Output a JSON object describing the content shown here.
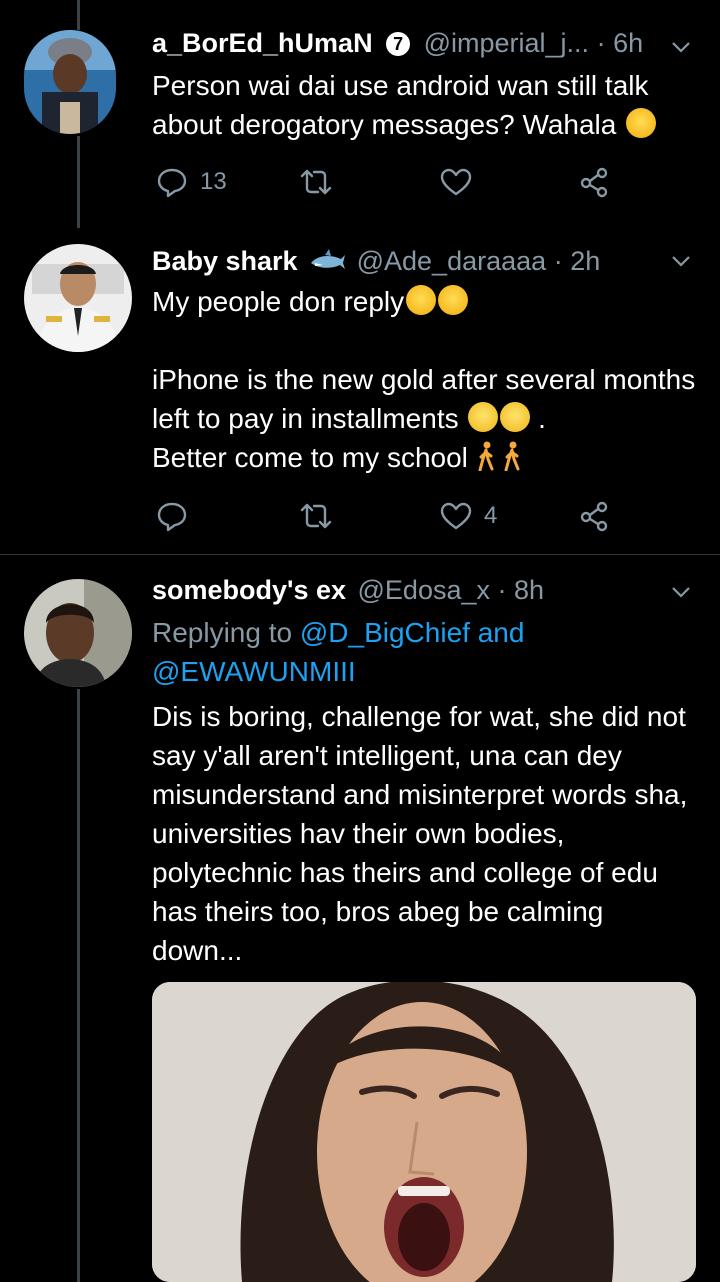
{
  "tweets": [
    {
      "display_name": "a_BorEd_hUmaN",
      "badge": "7",
      "handle": "@imperial_j...",
      "time": "6h",
      "text": "Person wai dai use android wan still talk about derogatory messages? Wahala",
      "replies": "13",
      "retweets": "",
      "likes": ""
    },
    {
      "display_name": "Baby shark",
      "handle": "@Ade_daraaaa",
      "time": "2h",
      "text_line1": "My people don reply",
      "text_para2a": "iPhone is the new gold after several months left to pay in installments",
      "text_para2b": ".",
      "text_para2c": "Better come to my school",
      "replies": "",
      "retweets": "",
      "likes": "4"
    },
    {
      "display_name": "somebody's ex",
      "handle": "@Edosa_x",
      "time": "8h",
      "replying_prefix": "Replying to",
      "replying_user1": "@D_BigChief",
      "replying_and": "and",
      "replying_user2": "@EWAWUNMIII",
      "text": "Dis is boring, challenge for wat, she did not say y'all aren't intelligent, una can dey misunderstand and misinterpret words sha, universities hav their own bodies, polytechnic has theirs and college of edu has theirs too, bros abeg be calming down..."
    }
  ],
  "colors": {
    "background": "#000000",
    "secondary_text": "#8899a6",
    "link": "#1da1f2",
    "divider": "#2f3336"
  },
  "icons": [
    "reply-icon",
    "retweet-icon",
    "like-icon",
    "share-icon",
    "chevron-down-icon",
    "shark-emoji",
    "laughing-emoji",
    "eye-roll-emoji",
    "walking-emoji"
  ]
}
